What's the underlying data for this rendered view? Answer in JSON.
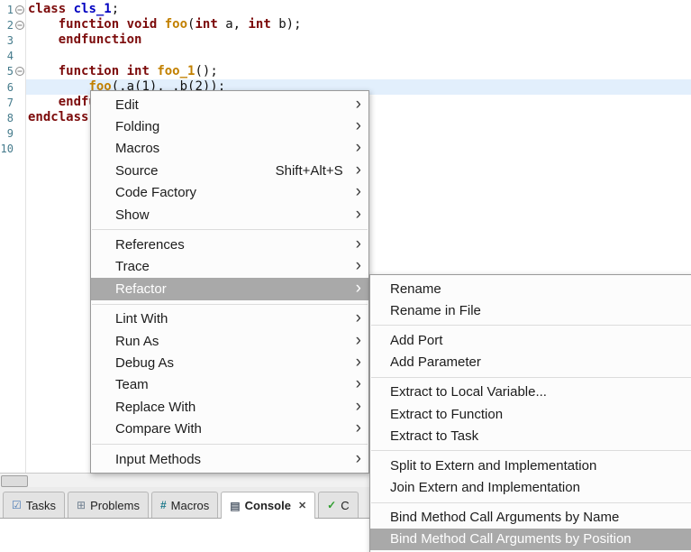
{
  "editor": {
    "lines": [
      {
        "num": "1",
        "fold": true,
        "current": false,
        "segments": [
          [
            "kw",
            "class"
          ],
          [
            "pl",
            " "
          ],
          [
            "ty",
            "cls_1"
          ],
          [
            "pl",
            ";"
          ]
        ]
      },
      {
        "num": "2",
        "fold": true,
        "current": false,
        "segments": [
          [
            "pl",
            "    "
          ],
          [
            "kw",
            "function"
          ],
          [
            "pl",
            " "
          ],
          [
            "kw",
            "void"
          ],
          [
            "pl",
            " "
          ],
          [
            "fn",
            "foo"
          ],
          [
            "pl",
            "("
          ],
          [
            "kw",
            "int"
          ],
          [
            "pl",
            " a, "
          ],
          [
            "kw",
            "int"
          ],
          [
            "pl",
            " b);"
          ]
        ]
      },
      {
        "num": "3",
        "fold": false,
        "current": false,
        "segments": [
          [
            "pl",
            "    "
          ],
          [
            "kw",
            "endfunction"
          ]
        ]
      },
      {
        "num": "4",
        "fold": false,
        "current": false,
        "segments": []
      },
      {
        "num": "5",
        "fold": true,
        "current": false,
        "segments": [
          [
            "pl",
            "    "
          ],
          [
            "kw",
            "function"
          ],
          [
            "pl",
            " "
          ],
          [
            "kw",
            "int"
          ],
          [
            "pl",
            " "
          ],
          [
            "fn",
            "foo_1"
          ],
          [
            "pl",
            "();"
          ]
        ]
      },
      {
        "num": "6",
        "fold": false,
        "current": true,
        "segments": [
          [
            "pl",
            "        "
          ],
          [
            "fn",
            "foo"
          ],
          [
            "pl",
            "(.a(1), .b(2));"
          ]
        ]
      },
      {
        "num": "7",
        "fold": false,
        "current": false,
        "segments": [
          [
            "pl",
            "    "
          ],
          [
            "kw",
            "endfunction"
          ]
        ]
      },
      {
        "num": "8",
        "fold": false,
        "current": false,
        "segments": [
          [
            "kw",
            "endclass"
          ]
        ]
      },
      {
        "num": "9",
        "fold": false,
        "current": false,
        "segments": []
      },
      {
        "num": "10",
        "fold": false,
        "current": false,
        "segments": []
      }
    ]
  },
  "context_menu": {
    "arrow_glyph": "›",
    "items": [
      {
        "label": "Edit",
        "submenu": true
      },
      {
        "label": "Folding",
        "submenu": true
      },
      {
        "label": "Macros",
        "submenu": true
      },
      {
        "label": "Source",
        "accel": "Shift+Alt+S",
        "submenu": true
      },
      {
        "label": "Code Factory",
        "submenu": true
      },
      {
        "label": "Show",
        "submenu": true
      },
      {
        "separator": true
      },
      {
        "label": "References",
        "submenu": true
      },
      {
        "label": "Trace",
        "submenu": true
      },
      {
        "label": "Refactor",
        "submenu": true,
        "highlighted": true
      },
      {
        "separator": true
      },
      {
        "label": "Lint With",
        "submenu": true
      },
      {
        "label": "Run As",
        "submenu": true
      },
      {
        "label": "Debug As",
        "submenu": true
      },
      {
        "label": "Team",
        "submenu": true
      },
      {
        "label": "Replace With",
        "submenu": true
      },
      {
        "label": "Compare With",
        "submenu": true
      },
      {
        "separator": true
      },
      {
        "label": "Input Methods",
        "submenu": true
      }
    ]
  },
  "refactor_submenu": {
    "items": [
      {
        "label": "Rename"
      },
      {
        "label": "Rename in File"
      },
      {
        "separator": true
      },
      {
        "label": "Add Port"
      },
      {
        "label": "Add Parameter"
      },
      {
        "separator": true
      },
      {
        "label": "Extract to Local Variable..."
      },
      {
        "label": "Extract to Function"
      },
      {
        "label": "Extract to Task"
      },
      {
        "separator": true
      },
      {
        "label": "Split to Extern and Implementation"
      },
      {
        "label": "Join Extern and Implementation"
      },
      {
        "separator": true
      },
      {
        "label": "Bind Method Call Arguments by Name"
      },
      {
        "label": "Bind Method Call Arguments by Position",
        "highlighted": true
      }
    ]
  },
  "bottom_tabs": [
    {
      "label": "Tasks",
      "icon": "tasks-icon",
      "glyph": "☑"
    },
    {
      "label": "Problems",
      "icon": "problems-icon",
      "glyph": "⊞"
    },
    {
      "label": "Macros",
      "icon": "macros-icon",
      "glyph": "#"
    },
    {
      "label": "Console",
      "icon": "console-icon",
      "glyph": "▤",
      "active": true,
      "close": "✕"
    },
    {
      "label": "C",
      "icon": "check-icon",
      "glyph": "✓",
      "partial": true
    }
  ],
  "colors": {
    "keyword": "#7c0b0b",
    "class_name": "#0000c0",
    "function_name": "#c28000",
    "line_number": "#457b8c",
    "current_line_bg": "#e2effc",
    "menu_highlight_bg": "#a9a9a9",
    "menu_highlight_text": "#ffffff"
  }
}
